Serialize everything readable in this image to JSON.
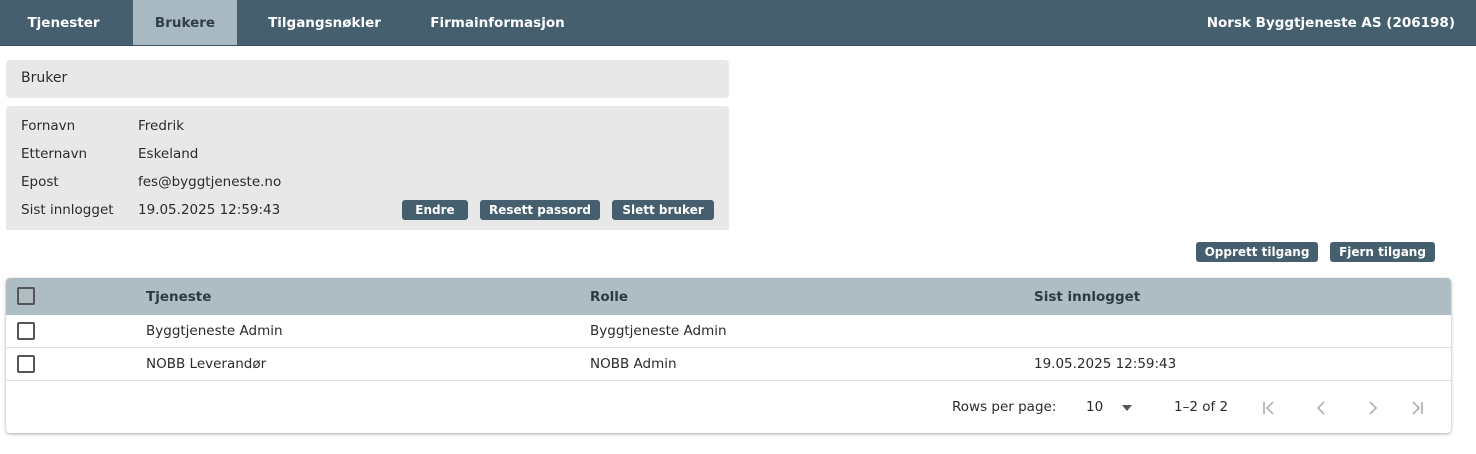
{
  "nav": {
    "tabs": [
      {
        "label": "Tjenester"
      },
      {
        "label": "Brukere"
      },
      {
        "label": "Tilgangsnøkler"
      },
      {
        "label": "Firmainformasjon"
      }
    ],
    "active_tab": "Brukere",
    "company": "Norsk Byggtjeneste AS (206198)"
  },
  "user_panel": {
    "title": "Bruker",
    "fields": [
      {
        "label": "Fornavn",
        "value": "Fredrik"
      },
      {
        "label": "Etternavn",
        "value": "Eskeland"
      },
      {
        "label": "Epost",
        "value": "fes@byggtjeneste.no"
      },
      {
        "label": "Sist innlogget",
        "value": "19.05.2025 12:59:43"
      }
    ],
    "buttons": {
      "edit": "Endre",
      "reset_password": "Resett passord",
      "delete_user": "Slett bruker"
    }
  },
  "access_actions": {
    "create": "Opprett tilgang",
    "remove": "Fjern tilgang"
  },
  "table": {
    "columns": [
      "Tjeneste",
      "Rolle",
      "Sist innlogget"
    ],
    "rows": [
      {
        "service": "Byggtjeneste Admin",
        "role": "Byggtjeneste Admin",
        "last_login": "",
        "checked": false
      },
      {
        "service": "NOBB Leverandør",
        "role": "NOBB Admin",
        "last_login": "19.05.2025 12:59:43",
        "checked": false
      }
    ],
    "footer": {
      "rows_per_page_label": "Rows per page:",
      "rows_per_page": "10",
      "range": "1–2 of 2"
    }
  },
  "colors": {
    "nav_bg": "#455f6f",
    "active_tab_bg": "#a9b9c2",
    "panel_bg": "#e8e8e8",
    "table_header_bg": "#aebcc4",
    "button_bg": "#455f6f"
  },
  "icons": {
    "first_page": "first-page-icon",
    "prev_page": "chevron-left-icon",
    "next_page": "chevron-right-icon",
    "last_page": "last-page-icon",
    "dropdown": "caret-down-icon"
  }
}
